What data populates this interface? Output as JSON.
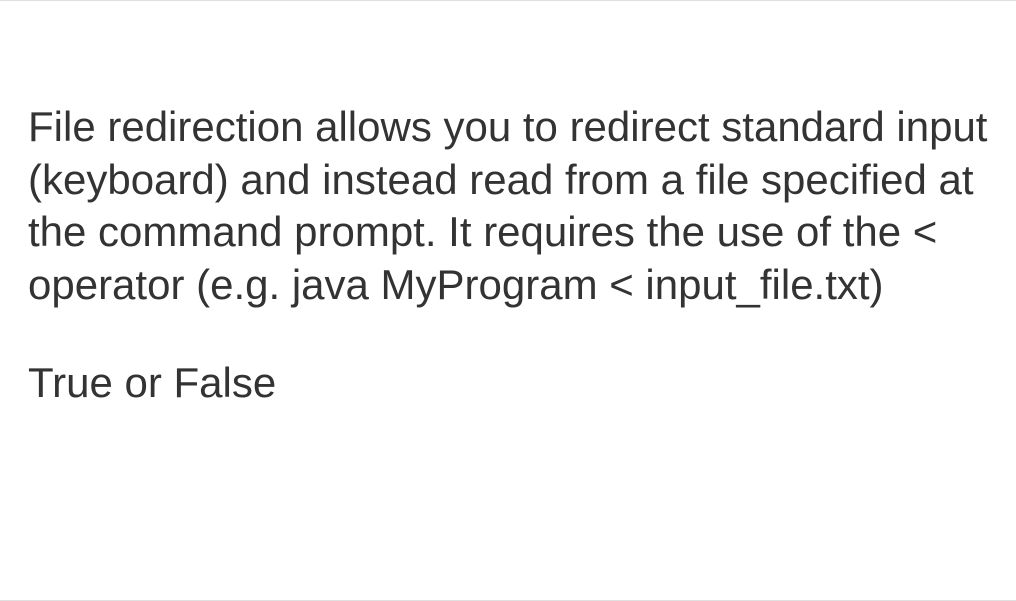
{
  "question": {
    "body": "File redirection allows you to redirect standard input (keyboard) and instead read from a file specified at the command prompt. It requires the use of the < operator (e.g. java MyProgram < input_file.txt)",
    "prompt": "True or False"
  }
}
